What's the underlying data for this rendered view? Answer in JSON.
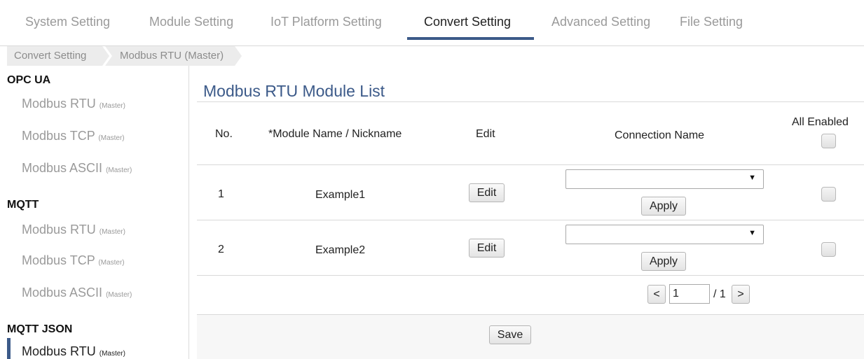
{
  "topnav": {
    "tabs": [
      {
        "label": "System Setting"
      },
      {
        "label": "Module Setting"
      },
      {
        "label": "IoT Platform Setting"
      },
      {
        "label": "Convert Setting"
      },
      {
        "label": "Advanced Setting"
      },
      {
        "label": "File Setting"
      }
    ],
    "active_tab": "Convert Setting"
  },
  "breadcrumb": [
    "Convert Setting",
    "Modbus RTU (Master)"
  ],
  "sidebar": {
    "sections": [
      {
        "title": "OPC UA",
        "items": [
          {
            "name": "Modbus RTU",
            "suffix": "(Master)"
          },
          {
            "name": "Modbus TCP",
            "suffix": "(Master)"
          },
          {
            "name": "Modbus ASCII",
            "suffix": "(Master)"
          }
        ]
      },
      {
        "title": "MQTT",
        "items": [
          {
            "name": "Modbus RTU",
            "suffix": "(Master)"
          },
          {
            "name": "Modbus TCP",
            "suffix": "(Master)"
          },
          {
            "name": "Modbus ASCII",
            "suffix": "(Master)"
          }
        ]
      },
      {
        "title": "MQTT JSON",
        "items": [
          {
            "name": "Modbus RTU",
            "suffix": "(Master)"
          }
        ]
      }
    ]
  },
  "main": {
    "title": "Modbus RTU Module List",
    "columns": {
      "no": "No.",
      "module": "*Module Name / Nickname",
      "edit": "Edit",
      "connection": "Connection Name",
      "enabled": "All Enabled"
    },
    "rows": [
      {
        "no": "1",
        "module": "Example1",
        "edit_label": "Edit",
        "connection": "",
        "apply_label": "Apply"
      },
      {
        "no": "2",
        "module": "Example2",
        "edit_label": "Edit",
        "connection": "",
        "apply_label": "Apply"
      }
    ],
    "pager": {
      "prev": "<",
      "page": "1",
      "total": "/ 1",
      "next": ">"
    },
    "save_label": "Save"
  },
  "colors": {
    "accent": "#3c5a89",
    "inactive_text": "#9a9a9a"
  }
}
